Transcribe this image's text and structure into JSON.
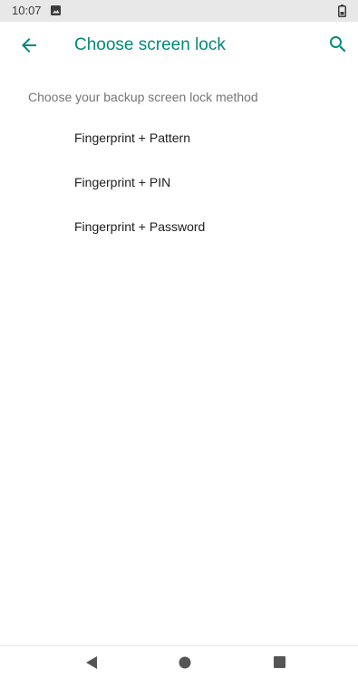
{
  "status_bar": {
    "time": "10:07",
    "icons": [
      "image-icon",
      "battery-icon"
    ]
  },
  "app_bar": {
    "title": "Choose screen lock",
    "back_icon": "arrow-back-icon",
    "search_icon": "search-icon",
    "accent_color": "#00897b"
  },
  "content": {
    "section_header": "Choose your backup screen lock method",
    "options": [
      {
        "label": "Fingerprint + Pattern"
      },
      {
        "label": "Fingerprint + PIN"
      },
      {
        "label": "Fingerprint + Password"
      }
    ]
  },
  "nav_bar": {
    "icons": [
      "nav-back-icon",
      "nav-home-icon",
      "nav-recents-icon"
    ]
  }
}
